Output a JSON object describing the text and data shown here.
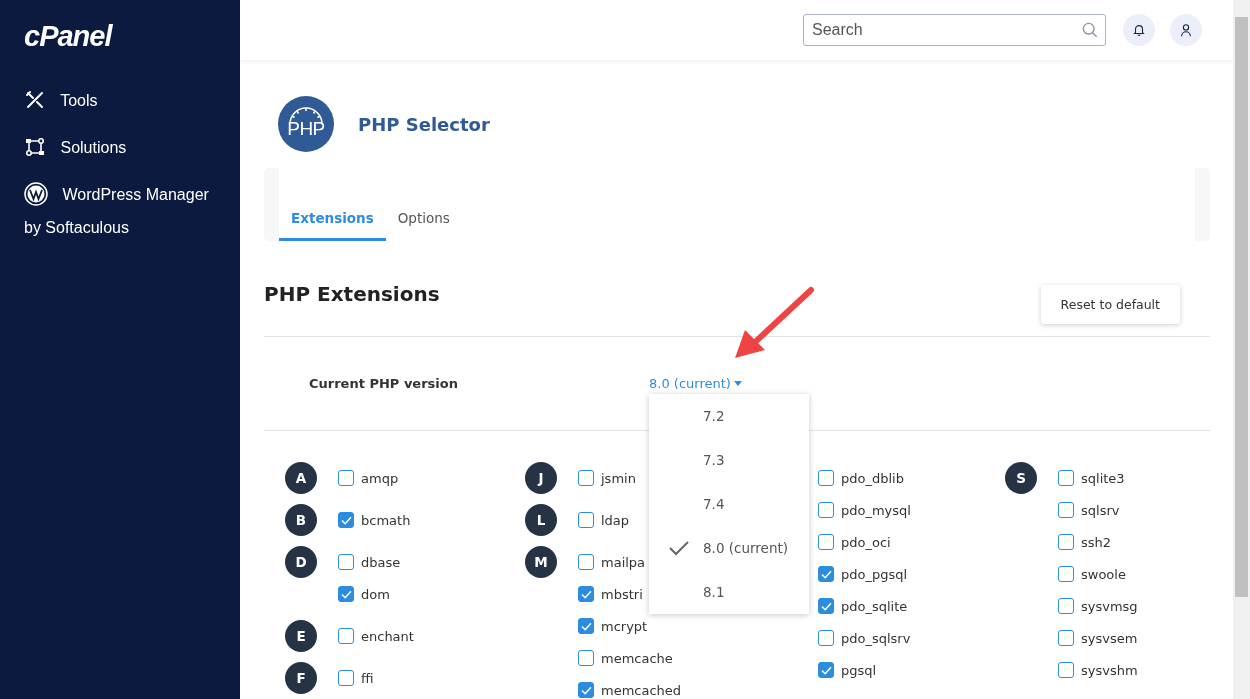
{
  "sidebar": {
    "logo": "cPanel",
    "items": [
      {
        "kind": "tools",
        "label": "Tools"
      },
      {
        "kind": "solutions",
        "label": "Solutions"
      },
      {
        "kind": "wordpress",
        "label": "WordPress Manager by Softaculous"
      }
    ]
  },
  "header": {
    "search": {
      "placeholder": "Search"
    }
  },
  "page": {
    "icon_text": "PHP",
    "title": "PHP Selector"
  },
  "tabs": [
    {
      "label": "Extensions",
      "selected": true
    },
    {
      "label": "Options",
      "selected": false
    }
  ],
  "section": {
    "title": "PHP Extensions",
    "reset_button": "Reset to default"
  },
  "version": {
    "label": "Current PHP version",
    "value": "8.0 (current)",
    "options": [
      {
        "label": "7.2",
        "selected": false
      },
      {
        "label": "7.3",
        "selected": false
      },
      {
        "label": "7.4",
        "selected": false
      },
      {
        "label": "8.0 (current)",
        "selected": true
      },
      {
        "label": "8.1",
        "selected": false
      }
    ]
  },
  "extension_columns": [
    {
      "groups": [
        {
          "letter": "A",
          "items": [
            {
              "name": "amqp",
              "checked": false
            }
          ]
        },
        {
          "letter": "B",
          "items": [
            {
              "name": "bcmath",
              "checked": true
            }
          ]
        },
        {
          "letter": "D",
          "items": [
            {
              "name": "dbase",
              "checked": false
            },
            {
              "name": "dom",
              "checked": true
            }
          ]
        },
        {
          "letter": "E",
          "items": [
            {
              "name": "enchant",
              "checked": false
            }
          ]
        },
        {
          "letter": "F",
          "items": [
            {
              "name": "ffi",
              "checked": false
            }
          ]
        }
      ]
    },
    {
      "groups": [
        {
          "letter": "J",
          "items": [
            {
              "name": "jsmin",
              "checked": false
            }
          ]
        },
        {
          "letter": "L",
          "items": [
            {
              "name": "ldap",
              "checked": false
            }
          ]
        },
        {
          "letter": "M",
          "items": [
            {
              "name": "mailpa",
              "checked": false
            },
            {
              "name": "mbstri",
              "checked": true
            },
            {
              "name": "mcrypt",
              "checked": true
            },
            {
              "name": "memcache",
              "checked": false
            },
            {
              "name": "memcached",
              "checked": true
            }
          ]
        }
      ]
    },
    {
      "groups": [
        {
          "items": [
            {
              "name": "pdo_dblib",
              "checked": false
            },
            {
              "name": "pdo_mysql",
              "checked": false
            },
            {
              "name": "pdo_oci",
              "checked": false
            },
            {
              "name": "pdo_pgsql",
              "checked": true
            },
            {
              "name": "pdo_sqlite",
              "checked": true
            },
            {
              "name": "pdo_sqlsrv",
              "checked": false
            },
            {
              "name": "pgsql",
              "checked": true
            }
          ]
        }
      ]
    },
    {
      "groups": [
        {
          "letter": "S",
          "items": [
            {
              "name": "sqlite3",
              "checked": false
            },
            {
              "name": "sqlsrv",
              "checked": false
            },
            {
              "name": "ssh2",
              "checked": false
            },
            {
              "name": "swoole",
              "checked": false
            },
            {
              "name": "sysvmsg",
              "checked": false
            },
            {
              "name": "sysvsem",
              "checked": false
            },
            {
              "name": "sysvshm",
              "checked": false
            }
          ]
        }
      ]
    }
  ]
}
